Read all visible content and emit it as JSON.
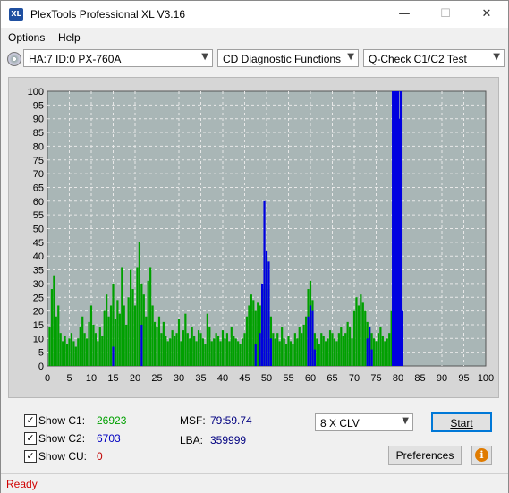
{
  "window": {
    "title": "PlexTools Professional XL V3.16",
    "icon_text": "XL",
    "minimize": "—",
    "maximize": "☐",
    "close": "✕"
  },
  "menu": {
    "options": "Options",
    "help": "Help"
  },
  "toolbar": {
    "drive": "HA:7 ID:0  PX-760A",
    "function": "CD Diagnostic Functions",
    "test": "Q-Check C1/C2 Test"
  },
  "chart_data": {
    "type": "bar",
    "title": "",
    "xlabel": "",
    "ylabel": "",
    "xlim": [
      0,
      100
    ],
    "ylim": [
      0,
      100
    ],
    "xticks": [
      0,
      5,
      10,
      15,
      20,
      25,
      30,
      35,
      40,
      45,
      50,
      55,
      60,
      65,
      70,
      75,
      80,
      85,
      90,
      95,
      100
    ],
    "yticks": [
      0,
      5,
      10,
      15,
      20,
      25,
      30,
      35,
      40,
      45,
      50,
      55,
      60,
      65,
      70,
      75,
      80,
      85,
      90,
      95,
      100
    ],
    "series": [
      {
        "color": "#00a000",
        "points": [
          [
            0.5,
            14
          ],
          [
            1,
            28
          ],
          [
            1.5,
            33
          ],
          [
            2,
            18
          ],
          [
            2.5,
            22
          ],
          [
            3,
            12
          ],
          [
            3.5,
            9
          ],
          [
            4,
            11
          ],
          [
            4.5,
            8
          ],
          [
            5,
            10
          ],
          [
            5.5,
            12
          ],
          [
            6,
            9
          ],
          [
            6.5,
            7
          ],
          [
            7,
            10
          ],
          [
            7.5,
            14
          ],
          [
            8,
            18
          ],
          [
            8.5,
            12
          ],
          [
            9,
            10
          ],
          [
            9.5,
            16
          ],
          [
            10,
            22
          ],
          [
            10.5,
            15
          ],
          [
            11,
            12
          ],
          [
            11.5,
            9
          ],
          [
            12,
            14
          ],
          [
            12.5,
            11
          ],
          [
            13,
            20
          ],
          [
            13.5,
            26
          ],
          [
            14,
            18
          ],
          [
            14.5,
            22
          ],
          [
            15,
            30
          ],
          [
            15.5,
            17
          ],
          [
            16,
            24
          ],
          [
            16.5,
            19
          ],
          [
            17,
            36
          ],
          [
            17.5,
            22
          ],
          [
            18,
            15
          ],
          [
            18.5,
            25
          ],
          [
            19,
            35
          ],
          [
            19.5,
            28
          ],
          [
            20,
            22
          ],
          [
            20.5,
            36
          ],
          [
            21,
            45
          ],
          [
            21.5,
            30
          ],
          [
            22,
            26
          ],
          [
            22.5,
            18
          ],
          [
            23,
            31
          ],
          [
            23.5,
            36
          ],
          [
            24,
            22
          ],
          [
            24.5,
            16
          ],
          [
            25,
            14
          ],
          [
            25.5,
            18
          ],
          [
            26,
            12
          ],
          [
            26.5,
            16
          ],
          [
            27,
            11
          ],
          [
            27.5,
            9
          ],
          [
            28,
            10
          ],
          [
            28.5,
            13
          ],
          [
            29,
            11
          ],
          [
            29.5,
            12
          ],
          [
            30,
            17
          ],
          [
            30.5,
            9
          ],
          [
            31,
            13
          ],
          [
            31.5,
            19
          ],
          [
            32,
            12
          ],
          [
            32.5,
            10
          ],
          [
            33,
            14
          ],
          [
            33.5,
            11
          ],
          [
            34,
            9
          ],
          [
            34.5,
            13
          ],
          [
            35,
            12
          ],
          [
            35.5,
            10
          ],
          [
            36,
            8
          ],
          [
            36.5,
            19
          ],
          [
            37,
            14
          ],
          [
            37.5,
            9
          ],
          [
            38,
            10
          ],
          [
            38.5,
            12
          ],
          [
            39,
            11
          ],
          [
            39.5,
            9
          ],
          [
            40,
            13
          ],
          [
            40.5,
            10
          ],
          [
            41,
            12
          ],
          [
            41.5,
            9
          ],
          [
            42,
            14
          ],
          [
            42.5,
            11
          ],
          [
            43,
            10
          ],
          [
            43.5,
            9
          ],
          [
            44,
            8
          ],
          [
            44.5,
            10
          ],
          [
            45,
            12
          ],
          [
            45.5,
            18
          ],
          [
            46,
            22
          ],
          [
            46.5,
            26
          ],
          [
            47,
            24
          ],
          [
            47.5,
            20
          ],
          [
            48,
            23
          ],
          [
            48.5,
            22
          ],
          [
            49,
            28
          ],
          [
            49.5,
            30
          ],
          [
            50,
            40
          ],
          [
            50.5,
            28
          ],
          [
            51,
            18
          ],
          [
            51.5,
            12
          ],
          [
            52,
            10
          ],
          [
            52.5,
            12
          ],
          [
            53,
            9
          ],
          [
            53.5,
            14
          ],
          [
            54,
            10
          ],
          [
            54.5,
            8
          ],
          [
            55,
            11
          ],
          [
            55.5,
            9
          ],
          [
            56,
            8
          ],
          [
            56.5,
            12
          ],
          [
            57,
            10
          ],
          [
            57.5,
            14
          ],
          [
            58,
            12
          ],
          [
            58.5,
            15
          ],
          [
            59,
            18
          ],
          [
            59.5,
            28
          ],
          [
            60,
            31
          ],
          [
            60.5,
            24
          ],
          [
            61,
            12
          ],
          [
            61.5,
            10
          ],
          [
            62,
            8
          ],
          [
            62.5,
            12
          ],
          [
            63,
            11
          ],
          [
            63.5,
            9
          ],
          [
            64,
            10
          ],
          [
            64.5,
            13
          ],
          [
            65,
            12
          ],
          [
            65.5,
            10
          ],
          [
            66,
            9
          ],
          [
            66.5,
            12
          ],
          [
            67,
            14
          ],
          [
            67.5,
            11
          ],
          [
            68,
            12
          ],
          [
            68.5,
            16
          ],
          [
            69,
            14
          ],
          [
            69.5,
            10
          ],
          [
            70,
            20
          ],
          [
            70.5,
            25
          ],
          [
            71,
            22
          ],
          [
            71.5,
            26
          ],
          [
            72,
            23
          ],
          [
            72.5,
            20
          ],
          [
            73,
            16
          ],
          [
            73.5,
            14
          ],
          [
            74,
            12
          ],
          [
            74.5,
            10
          ],
          [
            75,
            9
          ],
          [
            75.5,
            12
          ],
          [
            76,
            14
          ],
          [
            76.5,
            11
          ],
          [
            77,
            9
          ],
          [
            77.5,
            10
          ],
          [
            78,
            12
          ],
          [
            78.5,
            20
          ]
        ]
      },
      {
        "color": "#0000e0",
        "points": [
          [
            15,
            7
          ],
          [
            21.5,
            15
          ],
          [
            47.5,
            8
          ],
          [
            48.5,
            12
          ],
          [
            49,
            30
          ],
          [
            49.5,
            60
          ],
          [
            50,
            42
          ],
          [
            50.5,
            38
          ],
          [
            51,
            10
          ],
          [
            59.5,
            18
          ],
          [
            60,
            22
          ],
          [
            60.5,
            20
          ],
          [
            61,
            6
          ],
          [
            73,
            10
          ],
          [
            73.5,
            14
          ],
          [
            74,
            6
          ],
          [
            78.8,
            100
          ],
          [
            79.2,
            100
          ],
          [
            79.6,
            100
          ],
          [
            80,
            100
          ],
          [
            80.3,
            90
          ],
          [
            80.6,
            100
          ],
          [
            81,
            20
          ]
        ]
      }
    ]
  },
  "controls": {
    "show_c1_label": "Show C1:",
    "c1_value": "26923",
    "show_c2_label": "Show C2:",
    "c2_value": "6703",
    "show_cu_label": "Show CU:",
    "cu_value": "0",
    "msf_label": "MSF:",
    "msf_value": "79:59.74",
    "lba_label": "LBA:",
    "lba_value": "359999",
    "speed": "8 X CLV",
    "start_button": "Start",
    "preferences_button": "Preferences",
    "info_icon": "i",
    "check_mark": "✓"
  },
  "colors": {
    "c1": "#00a000",
    "c2": "#0000c0",
    "cu": "#c00000",
    "plot_bg": "#a9b6b6"
  },
  "status": {
    "text": "Ready"
  }
}
